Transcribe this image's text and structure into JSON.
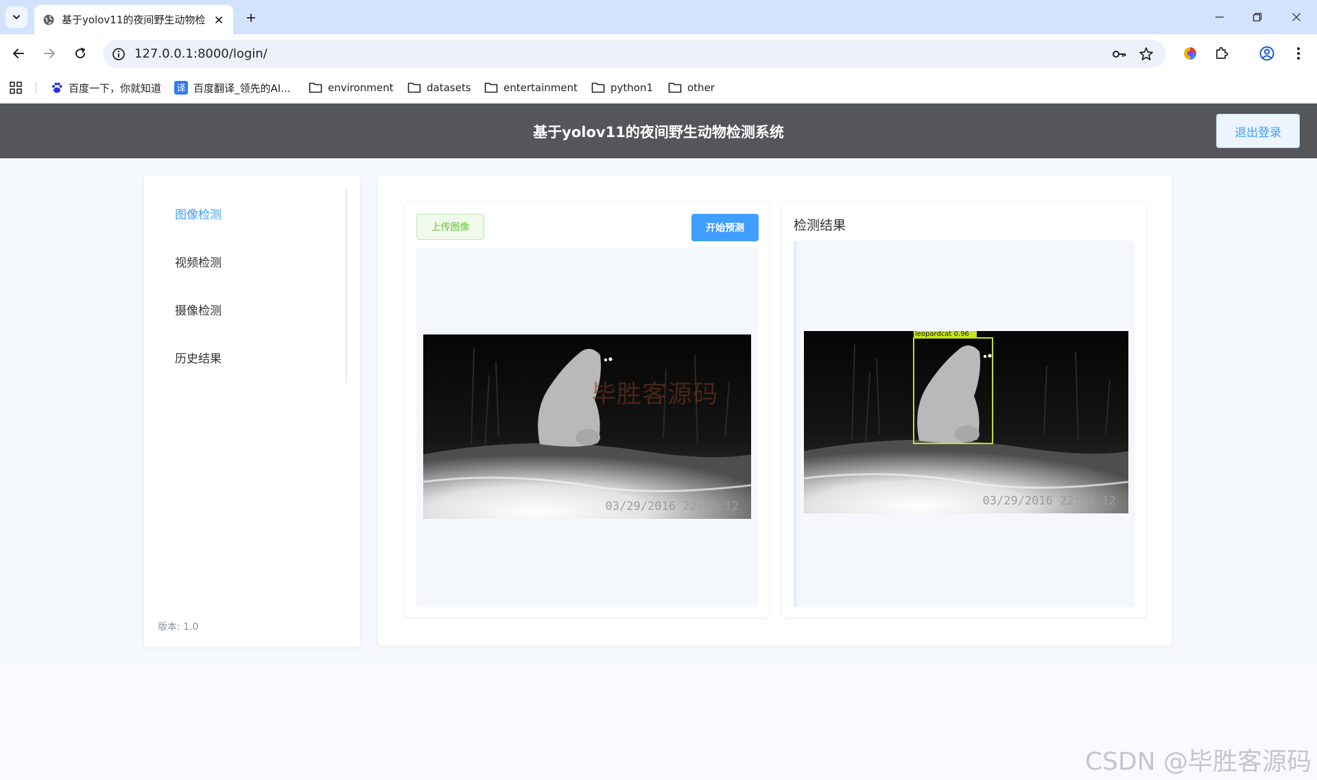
{
  "browser": {
    "tab_title": "基于yolov11的夜间野生动物检",
    "url": "127.0.0.1:8000/login/",
    "bookmarks": [
      {
        "label": "百度一下，你就知道",
        "icon": "baidu-paw-icon"
      },
      {
        "label": "百度翻译_领先的AI...",
        "icon": "baidu-translate-icon"
      },
      {
        "label": "environment",
        "icon": "folder-icon"
      },
      {
        "label": "datasets",
        "icon": "folder-icon"
      },
      {
        "label": "entertainment",
        "icon": "folder-icon"
      },
      {
        "label": "python1",
        "icon": "folder-icon"
      },
      {
        "label": "other",
        "icon": "folder-icon"
      }
    ]
  },
  "app": {
    "title": "基于yolov11的夜间野生动物检测系统",
    "logout_label": "退出登录"
  },
  "sidebar": {
    "items": [
      {
        "label": "图像检测",
        "active": true
      },
      {
        "label": "视频检测",
        "active": false
      },
      {
        "label": "摄像检测",
        "active": false
      },
      {
        "label": "历史结果",
        "active": false
      }
    ],
    "version": "版本: 1.0"
  },
  "detect": {
    "upload_label": "上传图像",
    "predict_label": "开始预测",
    "result_title": "检测结果",
    "input_image": {
      "overlay_text": "毕胜客源码",
      "timestamp": "03/29/2016 22:19:12"
    },
    "result_image": {
      "box_label": "leopardcat 0.96",
      "timestamp": "03/29/2016 22:19:12"
    }
  },
  "watermark": "CSDN @毕胜客源码",
  "colors": {
    "accent": "#409eff",
    "success": "#67c23a",
    "header": "#545659",
    "bbox": "#c8e01e"
  }
}
